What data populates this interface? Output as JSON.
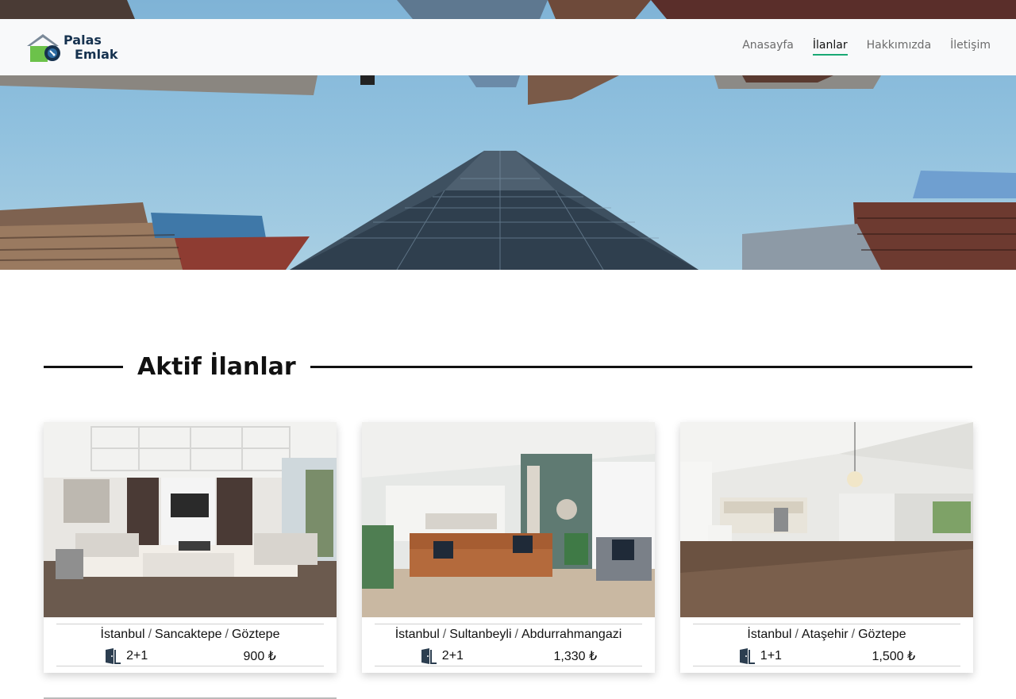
{
  "brand": {
    "line1": "Palas",
    "line2": "Emlak"
  },
  "nav": {
    "items": [
      {
        "label": "Anasayfa",
        "active": false
      },
      {
        "label": "İlanlar",
        "active": true
      },
      {
        "label": "Hakkımızda",
        "active": false
      },
      {
        "label": "İletişim",
        "active": false
      }
    ]
  },
  "section": {
    "title": "Aktif İlanlar"
  },
  "listings": [
    {
      "city": "İstanbul",
      "district": "Sancaktepe",
      "neighborhood": "Göztepe",
      "rooms": "2+1",
      "price": "900 ₺"
    },
    {
      "city": "İstanbul",
      "district": "Sultanbeyli",
      "neighborhood": "Abdurrahmangazi",
      "rooms": "2+1",
      "price": "1,330 ₺"
    },
    {
      "city": "İstanbul",
      "district": "Ataşehir",
      "neighborhood": "Göztepe",
      "rooms": "1+1",
      "price": "1,500 ₺"
    }
  ],
  "colors": {
    "accent": "#19a974",
    "brand_dark": "#16324f",
    "brand_green": "#6cc24a"
  }
}
